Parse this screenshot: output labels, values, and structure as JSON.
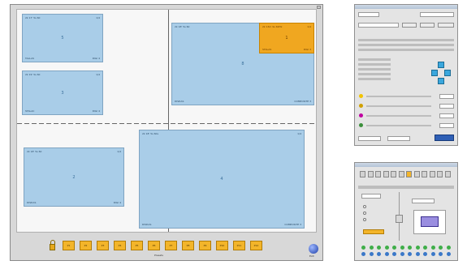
{
  "windows": [
    {
      "id": "w5",
      "num": "5",
      "tl": "2k 17' 5s 60",
      "tr": "1/4",
      "bl": "TALLAS",
      "br": "DIGI 4"
    },
    {
      "id": "w3",
      "num": "3",
      "tl": "2k 19' 5s 60",
      "tr": "1/4",
      "bl": "STALAC",
      "br": "DIGI 4"
    },
    {
      "id": "w8",
      "num": "8",
      "tl": "2k 18' 5s 60",
      "tr": "",
      "bl": "DISP.AS",
      "br": "COMPOSITE 3"
    },
    {
      "id": "w1",
      "num": "1",
      "tl": "2k 13m 9s 60Hz",
      "tr": "1/4",
      "bl": "STALAS",
      "br": "DIGI 3"
    },
    {
      "id": "w2",
      "num": "2",
      "tl": "2k 18' 5s 60",
      "tr": "1/4",
      "bl": "DISP.AS",
      "br": "DIGI 4"
    },
    {
      "id": "w4",
      "num": "4",
      "tl": "2k 18' 5s 60s",
      "tr": "1/4",
      "bl": "DISP.AS",
      "br": "COMPOSITE 3"
    }
  ],
  "toolbar": {
    "buttons": [
      "P1",
      "P2",
      "P3",
      "P4",
      "P5",
      "P6",
      "P7",
      "P8",
      "P9",
      "P10",
      "P11",
      "P12"
    ],
    "label": "Presets",
    "exit": "Exit"
  },
  "colors": {
    "window": "#a9cde8",
    "highlight": "#f0a720",
    "accent": "#3aa7dd",
    "button": "#f3b52a"
  }
}
